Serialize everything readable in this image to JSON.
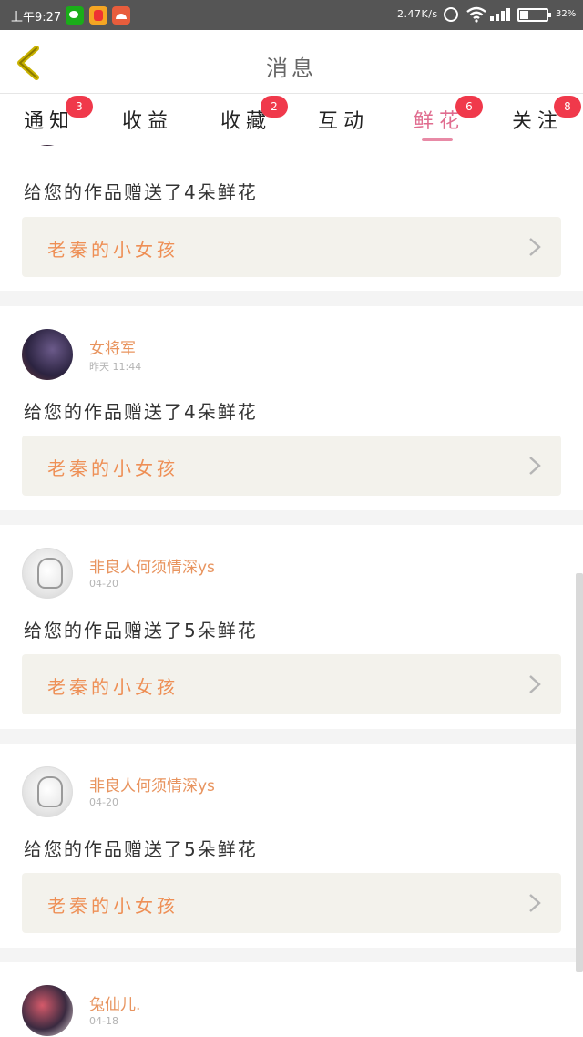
{
  "status_bar": {
    "time": "上午9:27",
    "net_speed": "2.47K/s",
    "battery_pct": "32%",
    "battery_level": 0.32,
    "icons": [
      "wechat-icon",
      "app-icon",
      "app-icon",
      "alarm-icon",
      "wifi-icon",
      "signal-icon",
      "battery-icon"
    ]
  },
  "header": {
    "title": "消息",
    "back_icon": "chevron-left-icon"
  },
  "tabs": [
    {
      "label": "通知",
      "badge": "3"
    },
    {
      "label": "收益",
      "badge": ""
    },
    {
      "label": "收藏",
      "badge": "2"
    },
    {
      "label": "互动",
      "badge": ""
    },
    {
      "label": "鲜花",
      "badge": "6",
      "active": true
    },
    {
      "label": "关注",
      "badge": "8"
    }
  ],
  "messages": [
    {
      "user": "",
      "time": "",
      "text": "给您的作品赠送了4朵鲜花",
      "work": "老秦的小女孩"
    },
    {
      "user": "女将军",
      "time": "昨天 11:44",
      "text": "给您的作品赠送了4朵鲜花",
      "work": "老秦的小女孩"
    },
    {
      "user": "非良人何须情深ys",
      "time": "04-20",
      "text": "给您的作品赠送了5朵鲜花",
      "work": "老秦的小女孩"
    },
    {
      "user": "非良人何须情深ys",
      "time": "04-20",
      "text": "给您的作品赠送了5朵鲜花",
      "work": "老秦的小女孩"
    },
    {
      "user": "兔仙儿.",
      "time": "04-18",
      "text": "",
      "work": ""
    }
  ],
  "colors": {
    "accent_pink": "#e06c8f",
    "username_orange": "#e8945f",
    "work_orange": "#ee8f55",
    "badge_red": "#f0394b",
    "work_box_bg": "#f3f2ec",
    "back_chevron": "#c9b200"
  }
}
